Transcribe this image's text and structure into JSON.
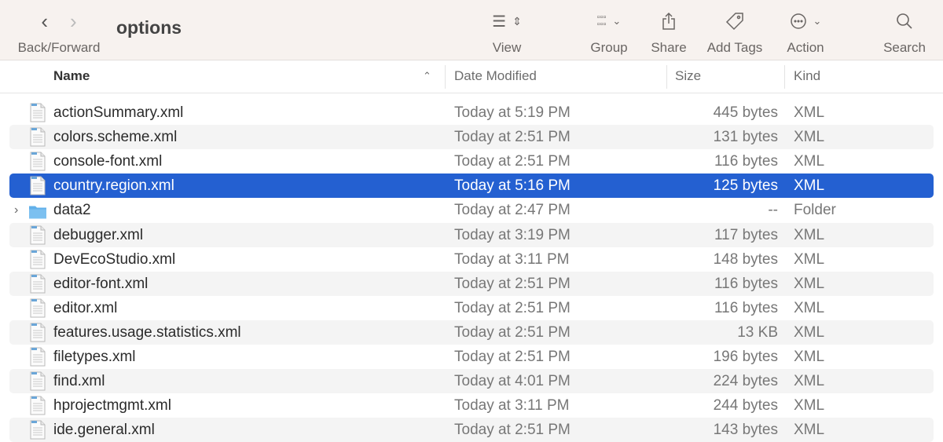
{
  "toolbar": {
    "back_forward_label": "Back/Forward",
    "title": "options",
    "view_label": "View",
    "group_label": "Group",
    "share_label": "Share",
    "add_tags_label": "Add Tags",
    "action_label": "Action",
    "search_label": "Search"
  },
  "columns": {
    "name": "Name",
    "date": "Date Modified",
    "size": "Size",
    "kind": "Kind"
  },
  "colors": {
    "selection": "#2460d1",
    "folder": "#62b0ea"
  },
  "files": [
    {
      "name": "actionSummary.xml",
      "date": "Today at 5:19 PM",
      "size": "445 bytes",
      "kind": "XML",
      "type": "file"
    },
    {
      "name": "colors.scheme.xml",
      "date": "Today at 2:51 PM",
      "size": "131 bytes",
      "kind": "XML",
      "type": "file"
    },
    {
      "name": "console-font.xml",
      "date": "Today at 2:51 PM",
      "size": "116 bytes",
      "kind": "XML",
      "type": "file"
    },
    {
      "name": "country.region.xml",
      "date": "Today at 5:16 PM",
      "size": "125 bytes",
      "kind": "XML",
      "type": "file",
      "selected": true
    },
    {
      "name": "data2",
      "date": "Today at 2:47 PM",
      "size": "--",
      "kind": "Folder",
      "type": "folder"
    },
    {
      "name": "debugger.xml",
      "date": "Today at 3:19 PM",
      "size": "117 bytes",
      "kind": "XML",
      "type": "file"
    },
    {
      "name": "DevEcoStudio.xml",
      "date": "Today at 3:11 PM",
      "size": "148 bytes",
      "kind": "XML",
      "type": "file"
    },
    {
      "name": "editor-font.xml",
      "date": "Today at 2:51 PM",
      "size": "116 bytes",
      "kind": "XML",
      "type": "file"
    },
    {
      "name": "editor.xml",
      "date": "Today at 2:51 PM",
      "size": "116 bytes",
      "kind": "XML",
      "type": "file"
    },
    {
      "name": "features.usage.statistics.xml",
      "date": "Today at 2:51 PM",
      "size": "13 KB",
      "kind": "XML",
      "type": "file"
    },
    {
      "name": "filetypes.xml",
      "date": "Today at 2:51 PM",
      "size": "196 bytes",
      "kind": "XML",
      "type": "file"
    },
    {
      "name": "find.xml",
      "date": "Today at 4:01 PM",
      "size": "224 bytes",
      "kind": "XML",
      "type": "file"
    },
    {
      "name": "hprojectmgmt.xml",
      "date": "Today at 3:11 PM",
      "size": "244 bytes",
      "kind": "XML",
      "type": "file"
    },
    {
      "name": "ide.general.xml",
      "date": "Today at 2:51 PM",
      "size": "143 bytes",
      "kind": "XML",
      "type": "file"
    }
  ]
}
